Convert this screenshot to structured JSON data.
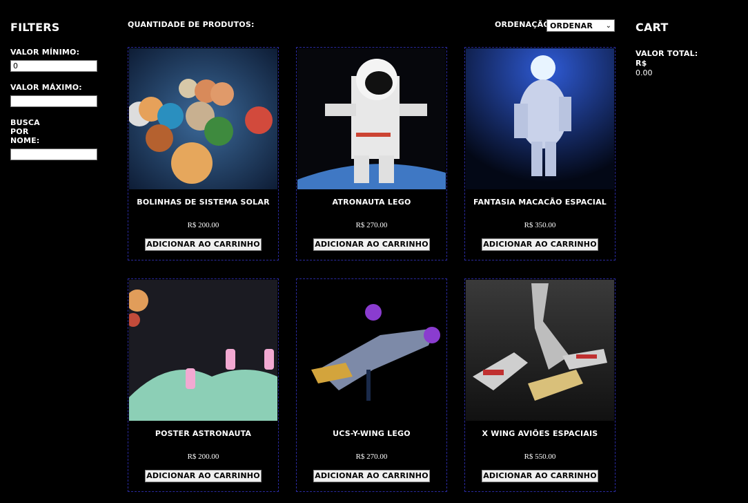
{
  "filters": {
    "title": "Filters",
    "min_label": "Valor mínimo:",
    "min_value": "0",
    "max_label": "Valor máximo:",
    "max_value": "",
    "name_label": "Busca por nome:",
    "name_value": ""
  },
  "header": {
    "quantity_label": "Quantidade de produtos:",
    "order_label": "Ordenação:",
    "order_selected": "Ordenar"
  },
  "cart": {
    "title": "Cart",
    "total_label": "Valor total: R$",
    "total_value": "0.00"
  },
  "products": [
    {
      "name": "Bolinhas de Sistema Solar",
      "price": "R$ 200.00",
      "button": "Adicionar ao carrinho"
    },
    {
      "name": "Atronauta Lego",
      "price": "R$ 270.00",
      "button": "Adicionar ao carrinho"
    },
    {
      "name": "Fantasia Macacão Espacial",
      "price": "R$ 350.00",
      "button": "Adicionar ao carrinho"
    },
    {
      "name": "Poster Astronauta",
      "price": "R$ 200.00",
      "button": "Adicionar ao carrinho"
    },
    {
      "name": "UCS-Y-Wing Lego",
      "price": "R$ 270.00",
      "button": "Adicionar ao carrinho"
    },
    {
      "name": "X Wing Aviões Espaciais",
      "price": "R$ 550.00",
      "button": "Adicionar ao carrinho"
    }
  ]
}
